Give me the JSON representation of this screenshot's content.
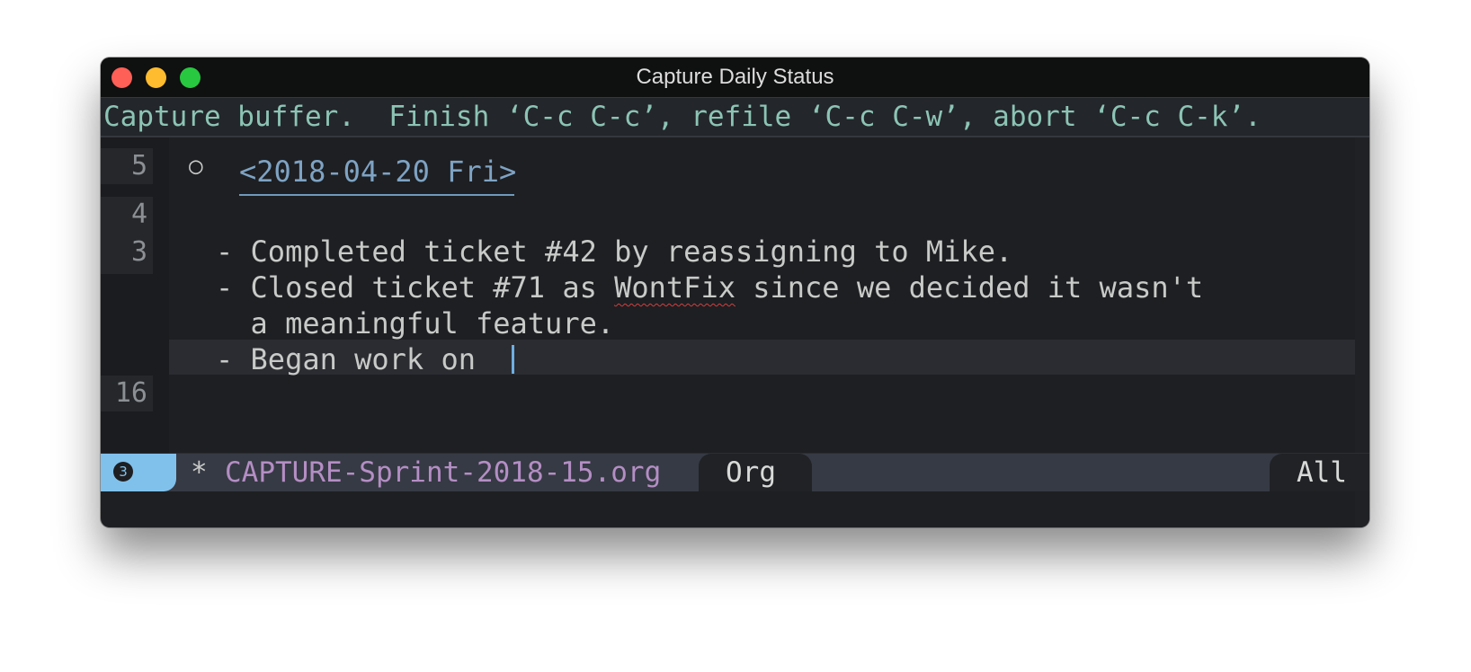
{
  "window": {
    "title": "Capture Daily Status",
    "controls": [
      "close",
      "minimize",
      "zoom"
    ]
  },
  "echo_area": {
    "message": "Capture buffer.  Finish ‘C-c C-c’, refile ‘C-c C-w’, abort ‘C-c C-k’."
  },
  "gutter": {
    "numbers": [
      "5",
      "4",
      "3",
      "16"
    ]
  },
  "editor": {
    "bullet": "○",
    "heading_date": "<2018-04-20 Fri>",
    "lines": [
      {
        "text": "- Completed ticket #42 by reassigning to Mike."
      },
      {
        "pre": "- Closed ticket #71 as ",
        "misspelled": "WontFix",
        "post": " since we decided it wasn't"
      },
      {
        "text": "  a meaningful feature."
      },
      {
        "text": "- Began work on "
      }
    ]
  },
  "modeline": {
    "window_number": "3",
    "modified": "*",
    "buffer_name": "CAPTURE-Sprint-2018-15.org",
    "major_mode": "Org",
    "position": "All"
  },
  "colors": {
    "accent": "#80c1ec",
    "buffer_name": "#b48ec4",
    "echo_text": "#8cc4b4",
    "date": "#7ea3c4"
  }
}
